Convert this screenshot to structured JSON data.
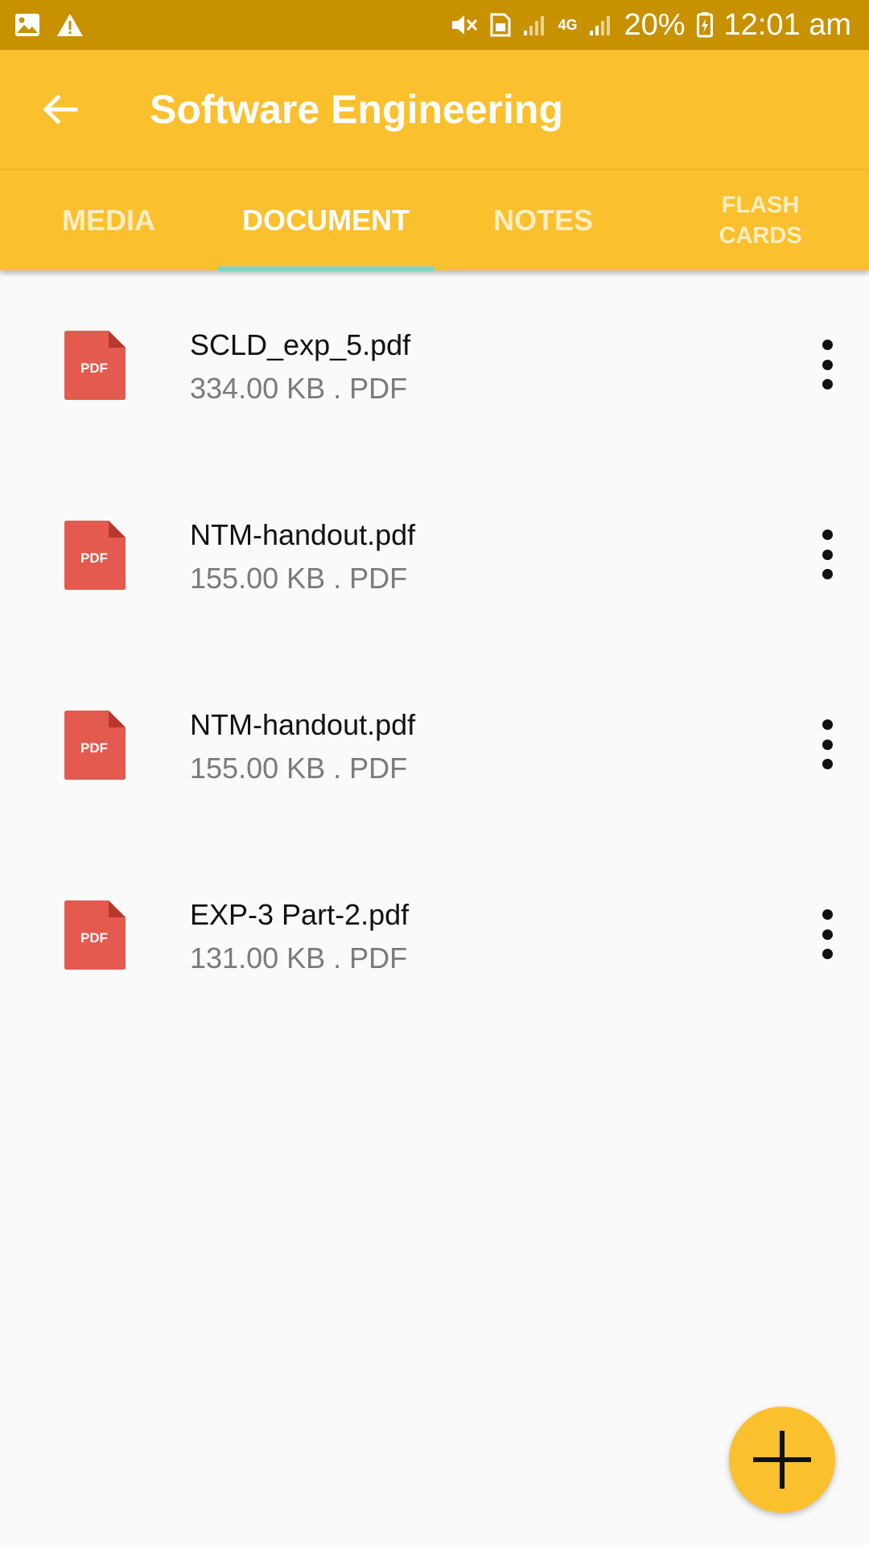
{
  "status_bar": {
    "battery": "20%",
    "time": "12:01 am",
    "network": "4G",
    "icons": [
      "image-icon",
      "warning-icon",
      "mute-icon",
      "sim-icon",
      "signal-icon",
      "battery-icon"
    ]
  },
  "app_bar": {
    "title": "Software Engineering",
    "back_icon": "arrow-back-icon"
  },
  "tabs": [
    {
      "label": "MEDIA",
      "active": false
    },
    {
      "label": "DOCUMENT",
      "active": true
    },
    {
      "label": "NOTES",
      "active": false
    },
    {
      "label": "FLASH\nCARDS",
      "active": false
    }
  ],
  "files": [
    {
      "name": "SCLD_exp_5.pdf",
      "meta": "334.00 KB . PDF",
      "icon_label": "PDF"
    },
    {
      "name": "NTM-handout.pdf",
      "meta": "155.00 KB . PDF",
      "icon_label": "PDF"
    },
    {
      "name": "NTM-handout.pdf",
      "meta": "155.00 KB . PDF",
      "icon_label": "PDF"
    },
    {
      "name": "EXP-3 Part-2.pdf",
      "meta": "131.00 KB . PDF",
      "icon_label": "PDF"
    }
  ],
  "colors": {
    "status_bar": "#c79100",
    "primary": "#fbc02d",
    "tab_indicator": "#7fd3c8",
    "pdf_red": "#e35a4f"
  }
}
